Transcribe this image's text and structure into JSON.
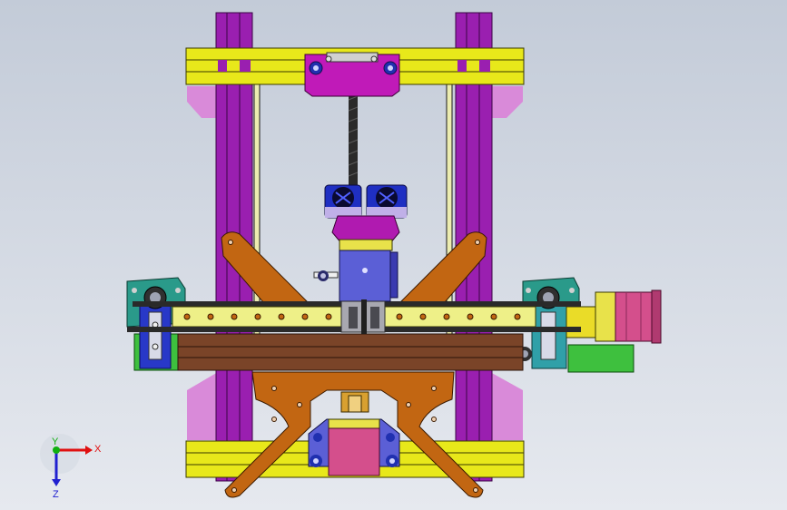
{
  "viewport": {
    "background_top": "#c3cbd8",
    "background_bottom": "#e6e9ef"
  },
  "colors": {
    "frame_purple": "#9a1fb0",
    "frame_purple_dark": "#5a0c6a",
    "crossbar_yellow": "#e8e81a",
    "corner_pink": "#d98ad9",
    "carriage_magenta": "#c01ab8",
    "bracket_orange": "#c26612",
    "rail_yellow": "#eef088",
    "rail_steel": "#bfc4cc",
    "bed_brown": "#7a4428",
    "motor_pink": "#d44f8c",
    "motor_blue": "#5b5fd6",
    "fan_blue": "#1f2fc2",
    "teal_bracket": "#2a9a8a",
    "green_block": "#3ec03e",
    "rod_black": "#202020"
  },
  "triad": {
    "x_label": "X",
    "y_label": "Y",
    "z_label": "Z",
    "x_color": "#e01010",
    "y_color": "#10b010",
    "z_color": "#2020d0"
  }
}
